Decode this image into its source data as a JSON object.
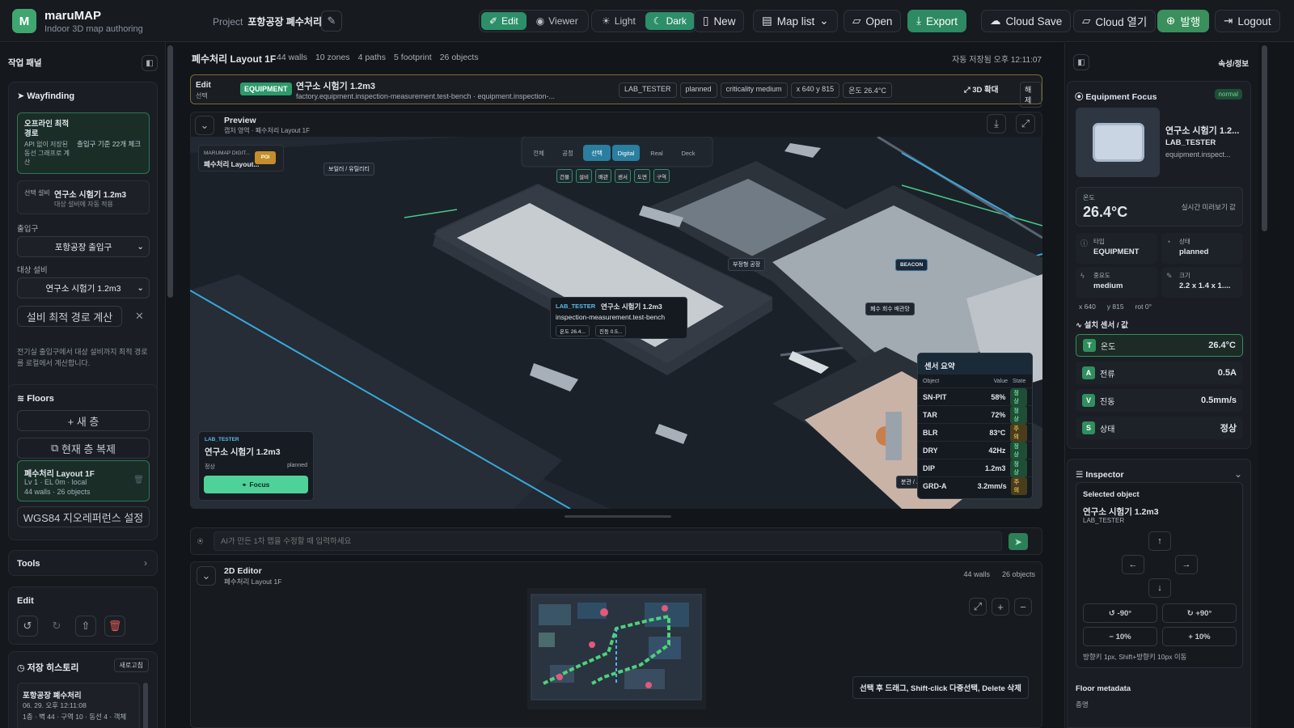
{
  "app": {
    "name": "maruMAP",
    "subtitle": "Indoor 3D map authoring",
    "logo_letter": "M"
  },
  "header": {
    "project_label": "Project",
    "project_name": "포항공장 폐수처리",
    "mode": {
      "edit": "Edit",
      "viewer": "Viewer"
    },
    "theme": {
      "light": "Light",
      "dark": "Dark"
    },
    "new": "New",
    "map_list": "Map list",
    "open": "Open",
    "export": "Export",
    "cloud_save": "Cloud Save",
    "cloud_open": "Cloud 열기",
    "publish": "발행",
    "logout": "Logout",
    "accent_color": "#2d8a62"
  },
  "left": {
    "panel_title": "작업 패널",
    "wayfinding": {
      "title": "Wayfinding",
      "offline_title": "오프라인 최적 경로",
      "offline_desc": "API 없이 저장된 동선 그래프로 계산",
      "offline_meta": "출입구 기준 22개 체크",
      "sel_label": "선택 설비",
      "sel_value": "연구소 시험기 1.2m3",
      "sel_sub": "대상 설비에 자동 적용",
      "entrance_label": "출입구",
      "entrance_value": "포항공장 출입구",
      "target_label": "대상 설비",
      "target_value": "연구소 시험기 1.2m3",
      "calc_button": "설비 최적 경로 계산",
      "note": "전기실 출입구에서 대상 설비까지 최적 경로를 로컬에서 계산합니다."
    },
    "floors": {
      "title": "Floors",
      "new": "+ 새 층",
      "copy": "현재 층 복제",
      "floor_name": "폐수처리 Layout 1F",
      "floor_meta1": "Lv 1 · EL 0m · local",
      "floor_meta2": "44 walls · 26 objects",
      "geo": "WGS84 지오레퍼런스 설정"
    },
    "tools": "Tools",
    "edit": "Edit",
    "history": {
      "title": "저장 히스토리",
      "refresh": "새로고침",
      "item_title": "포항공장 폐수처리",
      "item_time": "06. 29. 오후 12:11:08",
      "item_meta": "1층 · 벽 44 · 구역 10 · 동선 4 · 객체"
    }
  },
  "main": {
    "title": "폐수처리 Layout 1F",
    "stats": [
      "44 walls",
      "10 zones",
      "4 paths",
      "5 footprint",
      "26 objects"
    ],
    "autosave": "자동 저장됨 오후 12:11:07",
    "selection": {
      "edit": "Edit",
      "edit_sub": "선택",
      "type": "EQUIPMENT",
      "name": "연구소 시험기 1.2m3",
      "path": "factory.equipment.inspection-measurement.test-bench · equipment.inspection-...",
      "tags": [
        "LAB_TESTER",
        "planned",
        "criticality medium",
        "x 640 y 815",
        "온도 26.4°C"
      ],
      "zoom": "3D 확대",
      "release": "해제"
    },
    "preview": {
      "title": "Preview",
      "sub": "캡처 영역 · 폐수처리 Layout 1F"
    },
    "viewmodes": [
      "전체",
      "공정",
      "선택",
      "Digital",
      "Real",
      "Deck"
    ],
    "layers": [
      "건물",
      "설비",
      "배관",
      "센서",
      "도면",
      "구역"
    ],
    "map_labels": {
      "marumap": "MARUMAP DIGIT...",
      "layout": "폐수처리 Layout...",
      "poi": "POI",
      "boiler": "보일러 / 유틸리티",
      "floating": "부정형 공장",
      "beacon": "BEACON",
      "recovery": "폐수 회수 배관망",
      "bottom_right": "분관 / ..."
    },
    "tooltip": {
      "tag": "LAB_TESTER",
      "name": "연구소 시험기 1.2m3",
      "code": "inspection-measurement.test-bench",
      "t1": "온도 26.4...",
      "t2": "진동 0.5..."
    },
    "focus_card": {
      "tag": "LAB_TESTER",
      "name": "연구소 시험기 1.2m3",
      "status": "정상",
      "state": "planned",
      "button": "Focus"
    },
    "sensor_summary": {
      "title": "센서 요약",
      "cols": [
        "Object",
        "Value",
        "State"
      ],
      "rows": [
        {
          "name": "SN-PIT",
          "value": "58%",
          "state": "정상"
        },
        {
          "name": "TAR",
          "value": "72%",
          "state": "정상"
        },
        {
          "name": "BLR",
          "value": "83°C",
          "state": "주의"
        },
        {
          "name": "DRY",
          "value": "42Hz",
          "state": "정상"
        },
        {
          "name": "DIP",
          "value": "1.2m3",
          "state": "정상"
        },
        {
          "name": "GRD-A",
          "value": "3.2mm/s",
          "state": "주의"
        }
      ]
    },
    "ai_placeholder": "AI가 만든 1차 맵을 수정할 때 입력하세요",
    "editor2d": {
      "title": "2D Editor",
      "sub": "폐수처리 Layout 1F",
      "walls": "44 walls",
      "objects": "26 objects",
      "hint": "선택 후 드래그, Shift-click 다중선택, Delete 삭제"
    }
  },
  "right": {
    "title": "속성/정보",
    "focus": {
      "title": "Equipment Focus",
      "badge": "normal",
      "name": "연구소 시험기 1.2...",
      "tag": "LAB_TESTER",
      "code": "equipment.inspect...",
      "temp_label": "온도",
      "temp_value": "26.4°C",
      "temp_note": "실시간 미러보기 값",
      "type_label": "타입",
      "type_value": "EQUIPMENT",
      "state_label": "상태",
      "state_value": "planned",
      "crit_label": "중요도",
      "crit_value": "medium",
      "size_label": "크기",
      "size_value": "2.2 x 1.4 x 1....",
      "coords": [
        "x 640",
        "y 815",
        "rot 0°"
      ],
      "sensor_title": "설치 센서 / 값",
      "sensors": [
        {
          "key": "T",
          "label": "온도",
          "value": "26.4°C"
        },
        {
          "key": "A",
          "label": "전류",
          "value": "0.5A"
        },
        {
          "key": "V",
          "label": "진동",
          "value": "0.5mm/s"
        },
        {
          "key": "S",
          "label": "상태",
          "value": "정상"
        }
      ]
    },
    "inspector": {
      "title": "Inspector",
      "selected": "Selected object",
      "name": "연구소 시험기 1.2m3",
      "tag": "LAB_TESTER",
      "rot_minus": "-90°",
      "rot_plus": "+90°",
      "scale_minus": "10%",
      "scale_plus": "10%",
      "hint": "방향키 1px, Shift+방향키 10px 이동",
      "floor_meta": "Floor metadata",
      "floor_meta_sub": "층명"
    }
  }
}
